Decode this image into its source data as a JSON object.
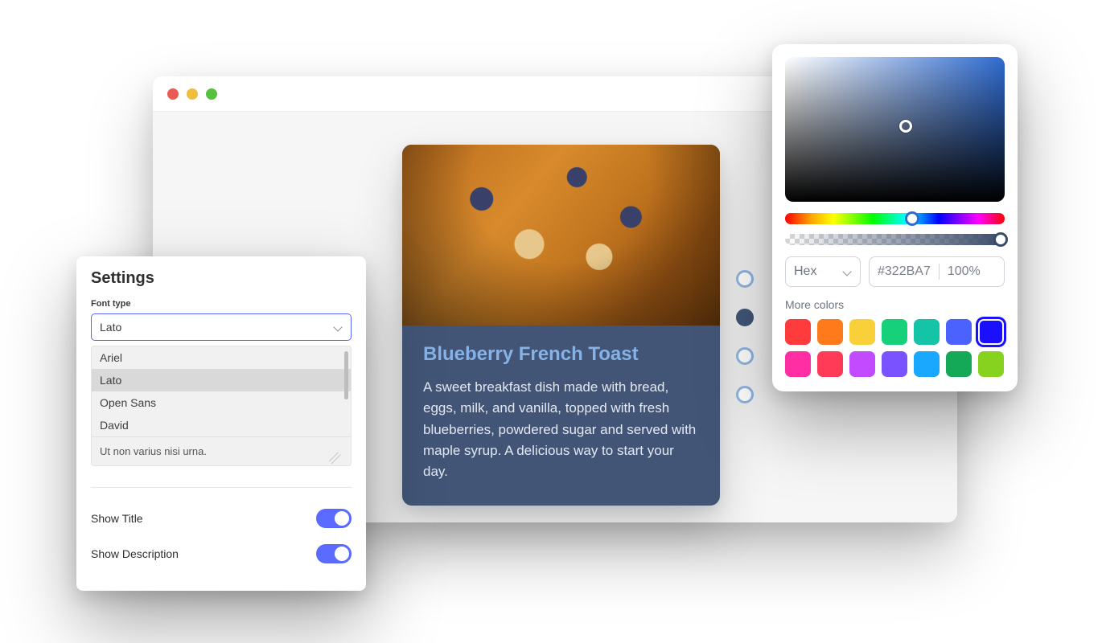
{
  "window": {
    "dots": [
      "red",
      "yellow",
      "green"
    ]
  },
  "card": {
    "title": "Blueberry French Toast",
    "description": "A sweet breakfast dish made with bread, eggs, milk, and vanilla, topped with fresh blueberries, powdered sugar and served with maple syrup. A delicious way to start your day."
  },
  "pager": {
    "count": 4,
    "active_index": 1
  },
  "settings": {
    "title": "Settings",
    "font_type_label": "Font type",
    "selected_font": "Lato",
    "font_options": [
      "Ariel",
      "Lato",
      "Open Sans",
      "David"
    ],
    "selected_option_index": 1,
    "placeholder_text": "Ut non varius nisi urna.",
    "toggles": [
      {
        "label": "Show Title",
        "on": true
      },
      {
        "label": "Show Description",
        "on": true
      }
    ]
  },
  "picker": {
    "mode": "Hex",
    "hex": "#322BA7",
    "opacity": "100%",
    "more_label": "More colors",
    "swatches_row1": [
      "#ff3b3b",
      "#ff7a1a",
      "#f9cf3a",
      "#17d07a",
      "#15c4a7",
      "#4b62ff",
      "#1a10ff"
    ],
    "swatches_row2": [
      "#ff2fa3",
      "#ff3b57",
      "#c24bff",
      "#7b52ff",
      "#1aa8ff",
      "#14a957",
      "#87d11f"
    ],
    "selected_swatch_index": 6
  }
}
